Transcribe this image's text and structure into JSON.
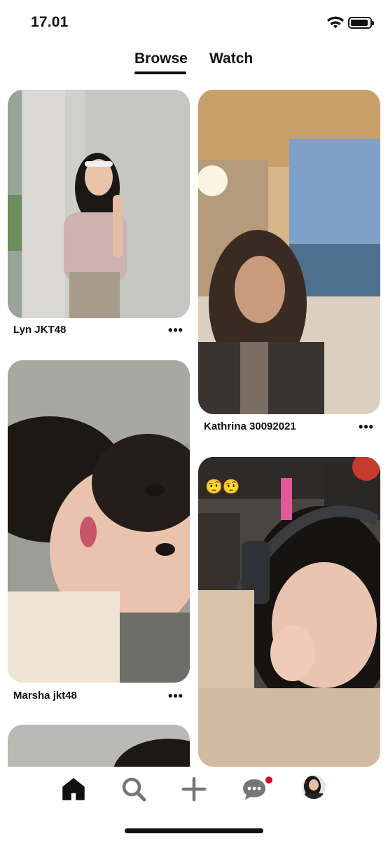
{
  "status_bar": {
    "time": "17.01"
  },
  "tabs": [
    {
      "label": "Browse",
      "active": true
    },
    {
      "label": "Watch",
      "active": false
    }
  ],
  "pins": [
    {
      "caption": "Lyn JKT48",
      "more_label": "•••"
    },
    {
      "caption": "Kathrina 30092021",
      "more_label": "•••"
    },
    {
      "caption": "Marsha jkt48",
      "more_label": "•••"
    },
    {
      "caption": "",
      "emoji": "🤨🤨"
    },
    {
      "caption": ""
    }
  ],
  "bottom_nav": [
    {
      "icon": "home-icon",
      "active": true
    },
    {
      "icon": "search-icon"
    },
    {
      "icon": "plus-icon"
    },
    {
      "icon": "chat-icon",
      "badge": true
    },
    {
      "icon": "profile-avatar"
    }
  ],
  "colors": {
    "accent": "#e60023",
    "text": "#111111",
    "background": "#ffffff"
  }
}
